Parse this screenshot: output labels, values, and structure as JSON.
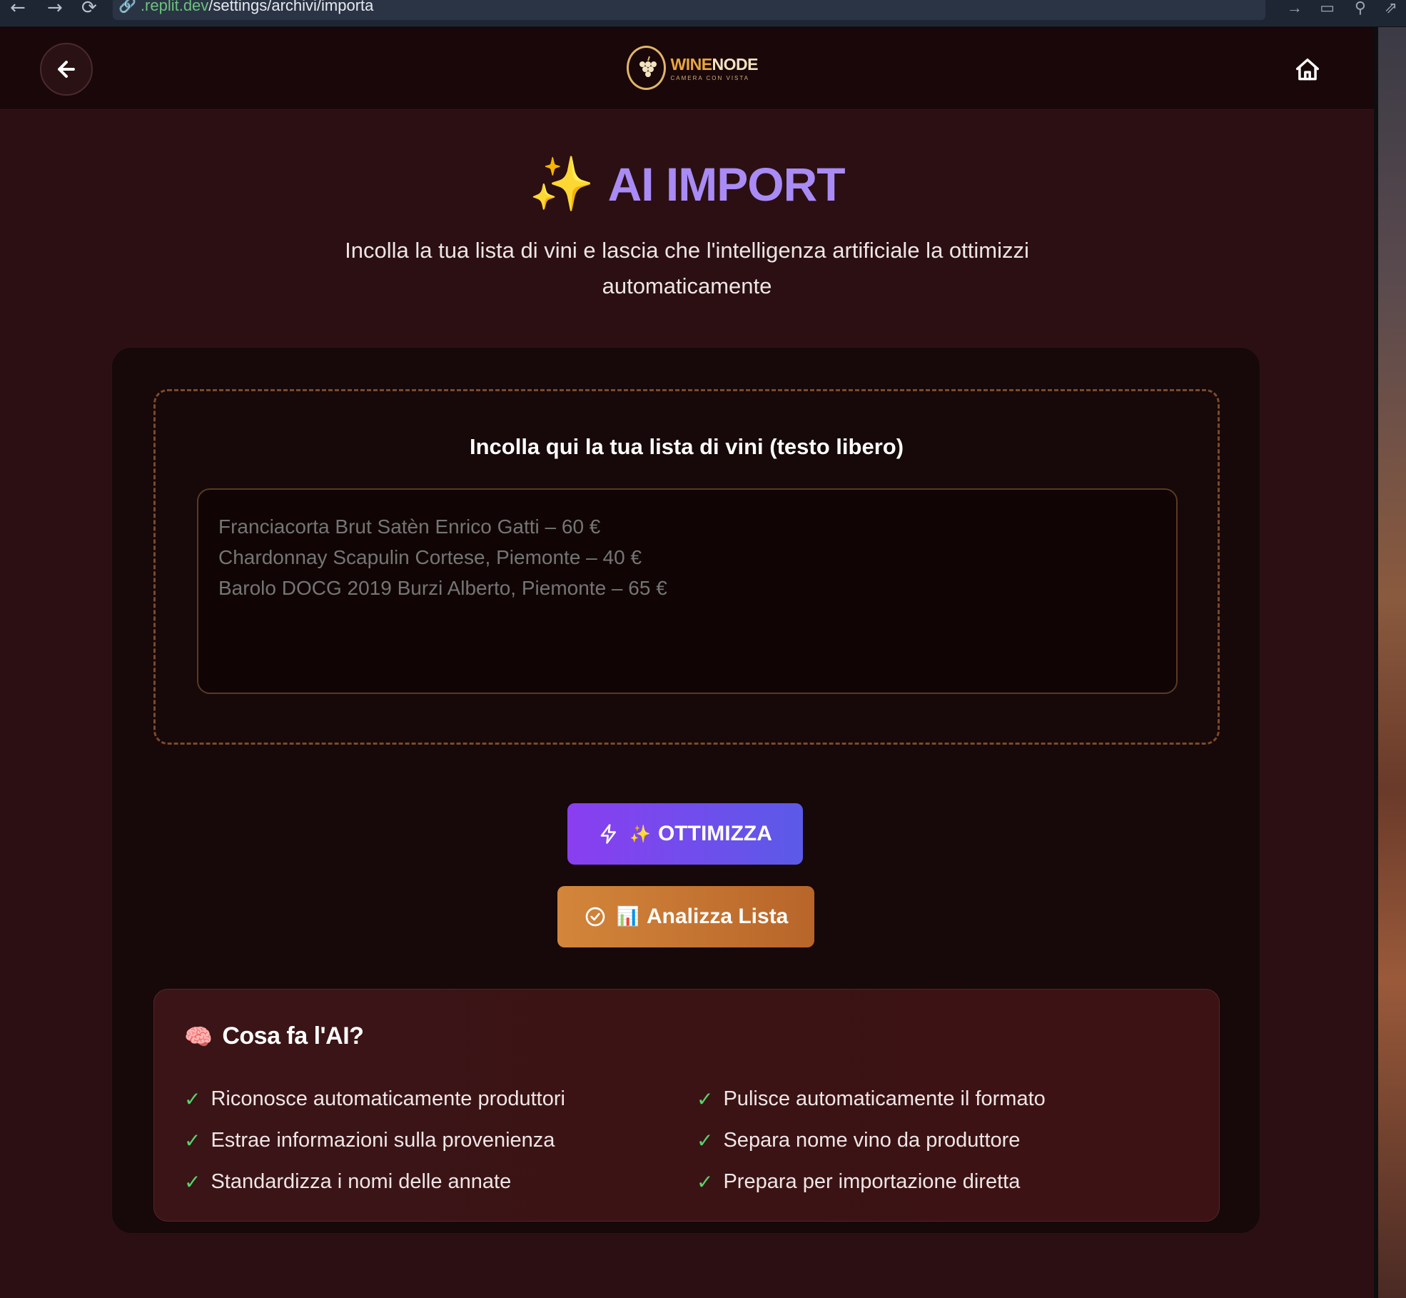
{
  "browser": {
    "url_prefix": ".replit.dev",
    "url_path": "/settings/archivi/importa"
  },
  "nav": {
    "logo_brand_1": "WINE",
    "logo_brand_2": "NODE",
    "logo_sub": "CAMERA CON VISTA"
  },
  "header": {
    "title_emoji": "✨",
    "title": "AI IMPORT",
    "subtitle": "Incolla la tua lista di vini e lascia che l'intelligenza artificiale la ottimizzi automaticamente"
  },
  "dropzone": {
    "label": "Incolla qui la tua lista di vini (testo libero)",
    "placeholder": "Franciacorta Brut Satèn Enrico Gatti – 60 €\nChardonnay Scapulin Cortese, Piemonte – 40 €\nBarolo DOCG 2019 Burzi Alberto, Piemonte – 65 €",
    "value": ""
  },
  "actions": {
    "optimize_emoji": "✨",
    "optimize_label": "OTTIMIZZA",
    "analyze_emoji": "📊",
    "analyze_label": "Analizza Lista"
  },
  "info": {
    "emoji": "🧠",
    "title": "Cosa fa l'AI?",
    "left": [
      "Riconosce automaticamente produttori",
      "Estrae informazioni sulla provenienza",
      "Standardizza i nomi delle annate"
    ],
    "right": [
      "Pulisce automaticamente il formato",
      "Separa nome vino da produttore",
      "Prepara per importazione diretta"
    ]
  },
  "colors": {
    "accent_purple": "#a98bf5",
    "optimize_gradient": [
      "#8a3ef0",
      "#5b5ae8"
    ],
    "analyze_gradient": [
      "#d3863a",
      "#b8652a"
    ],
    "check_green": "#57d36b",
    "background": "#2c0f12"
  }
}
